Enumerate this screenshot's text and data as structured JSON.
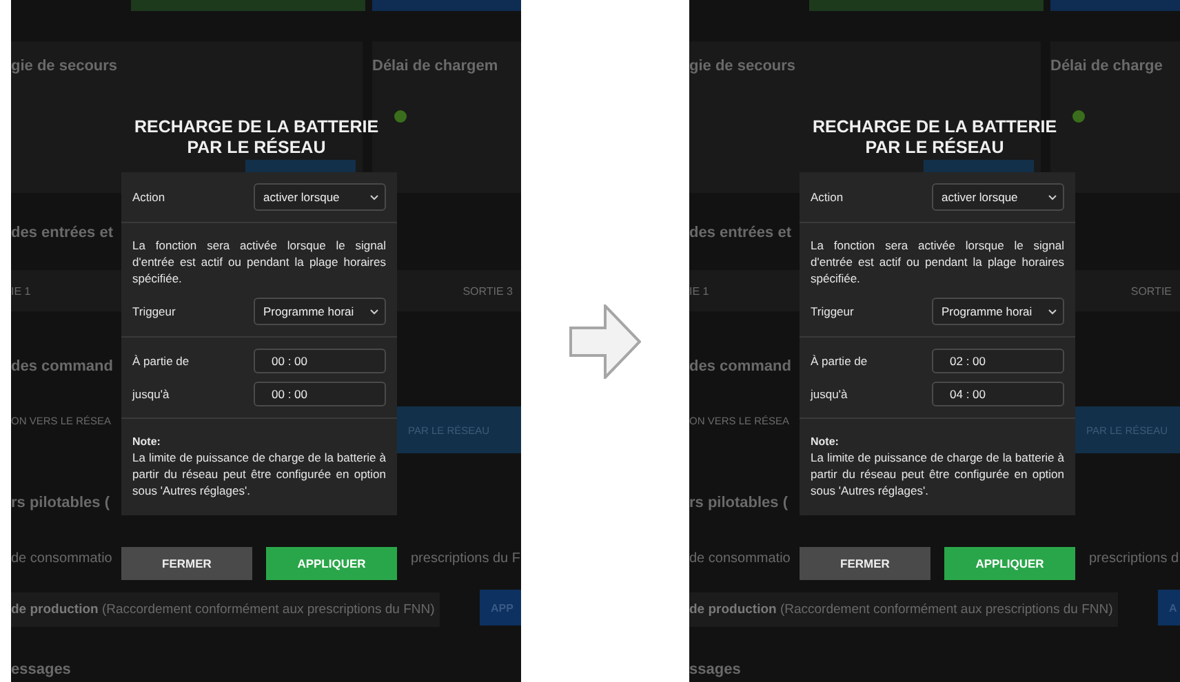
{
  "panels": [
    {
      "background": {
        "heading_1": "gie de secours",
        "heading_2": "Délai de chargem",
        "heading_3": "des entrées et",
        "output_1": "IE 1",
        "output_2": "SORTIE 3",
        "heading_4": "des command",
        "command_left": "ON VERS LE RÉSEA",
        "command_right": "PAR LE RÉSEAU",
        "heading_5": "rs pilotables (",
        "row_1_left": "de consommatio",
        "row_1_right": "prescriptions du F",
        "row_2_text": "**de production** (Raccordement conformément aux prescriptions du FNN)",
        "row_2_button": "APP",
        "heading_6": "essages"
      },
      "dialog": {
        "title": "RECHARGE DE LA BATTERIE PAR LE RÉSEAU",
        "action": {
          "label": "Action",
          "value": "activer lorsque"
        },
        "description": "La fonction sera activée lorsque le signal d'entrée est actif ou pendant la plage horaires spécifiée.",
        "trigger": {
          "label": "Triggeur",
          "value": "Programme horai"
        },
        "from": {
          "label": "À partie de",
          "value": "00 : 00"
        },
        "until": {
          "label": "jusqu'à",
          "value": "00 : 00"
        },
        "note": {
          "title": "Note:",
          "text": "La limite de puissance de charge de la batterie à partir du réseau peut être configurée en option sous 'Autres réglages'."
        },
        "buttons": [
          {
            "label": "FERMER",
            "kind": "secondary"
          },
          {
            "label": "APPLIQUER",
            "kind": "primary"
          }
        ]
      }
    },
    {
      "background": {
        "heading_1": "gie de secours",
        "heading_2": "Délai de charge",
        "heading_3": "des entrées et",
        "output_1": "IE 1",
        "output_2": "SORTIE",
        "heading_4": "des command",
        "command_left": "ON VERS LE RÉSEA",
        "command_right": "PAR LE RÉSEAU",
        "heading_5": "rs pilotables (",
        "row_1_left": "de consommatio",
        "row_1_right": "prescriptions d",
        "row_2_text": "**de production** (Raccordement conformément aux prescriptions du FNN)",
        "row_2_button": "A",
        "heading_6": "ssages"
      },
      "dialog": {
        "title": "RECHARGE DE LA BATTERIE PAR LE RÉSEAU",
        "action": {
          "label": "Action",
          "value": "activer lorsque"
        },
        "description": "La fonction sera activée lorsque le signal d'entrée est actif ou pendant la plage horaires spécifiée.",
        "trigger": {
          "label": "Triggeur",
          "value": "Programme horai"
        },
        "from": {
          "label": "À partie de",
          "value": "02 : 00"
        },
        "until": {
          "label": "jusqu'à",
          "value": "04 : 00"
        },
        "note": {
          "title": "Note:",
          "text": "La limite de puissance de charge de la batterie à partir du réseau peut être configurée en option sous 'Autres réglages'."
        },
        "buttons": [
          {
            "label": "FERMER",
            "kind": "secondary"
          },
          {
            "label": "APPLIQUER",
            "kind": "primary"
          }
        ]
      }
    }
  ]
}
